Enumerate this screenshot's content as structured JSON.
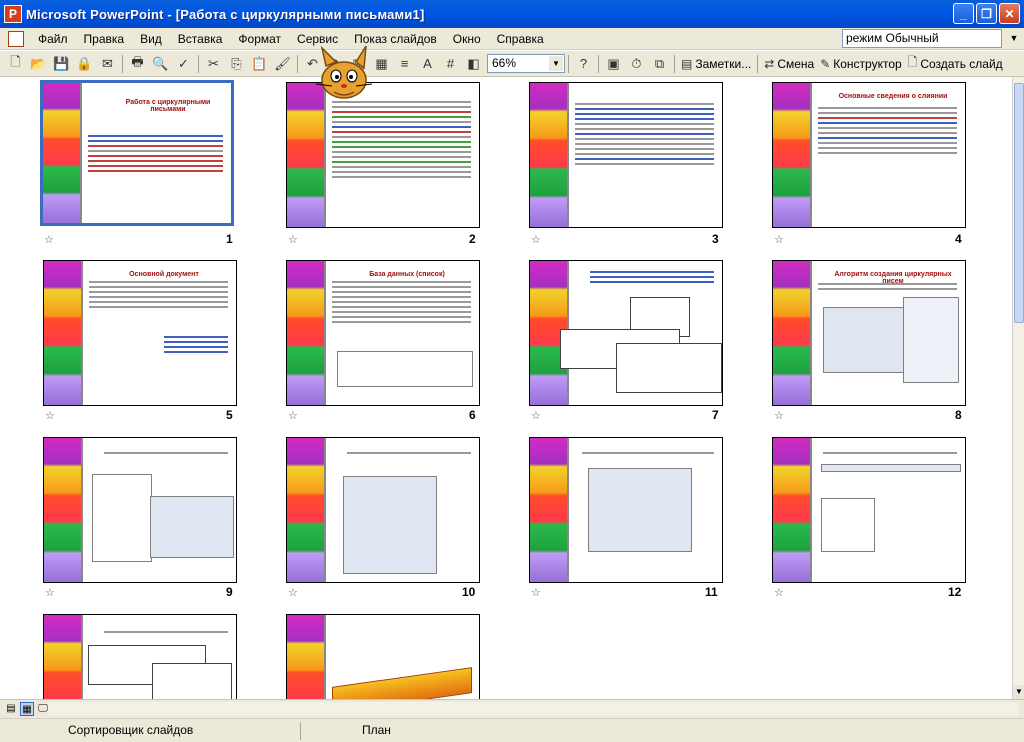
{
  "window": {
    "title": "Microsoft PowerPoint - [Работа с циркулярными письмами1]"
  },
  "menu": {
    "items": [
      "Файл",
      "Правка",
      "Вид",
      "Вставка",
      "Формат",
      "Сервис",
      "Показ слайдов",
      "Окно",
      "Справка"
    ],
    "view_mode": "режим Обычный"
  },
  "toolbar": {
    "zoom": "66%",
    "notes_label": "Заметки...",
    "change_label": "Смена",
    "designer_label": "Конструктор",
    "new_slide_label": "Создать слайд",
    "help_label": "?"
  },
  "slides": [
    {
      "number": "1",
      "title": "Работа с циркулярными письмами",
      "selected": true
    },
    {
      "number": "2",
      "title": "",
      "selected": false
    },
    {
      "number": "3",
      "title": "",
      "selected": false
    },
    {
      "number": "4",
      "title": "Основные сведения о слиянии",
      "selected": false
    },
    {
      "number": "5",
      "title": "Основной документ",
      "selected": false
    },
    {
      "number": "6",
      "title": "База данных (список)",
      "selected": false
    },
    {
      "number": "7",
      "title": "",
      "selected": false
    },
    {
      "number": "8",
      "title": "Алгоритм создания циркулярных писем",
      "selected": false
    },
    {
      "number": "9",
      "title": "",
      "selected": false
    },
    {
      "number": "10",
      "title": "",
      "selected": false
    },
    {
      "number": "11",
      "title": "",
      "selected": false
    },
    {
      "number": "12",
      "title": "",
      "selected": false
    },
    {
      "number": "",
      "title": "",
      "selected": false
    },
    {
      "number": "",
      "title": "",
      "selected": false
    }
  ],
  "status": {
    "view": "Сортировщик слайдов",
    "design": "План"
  }
}
